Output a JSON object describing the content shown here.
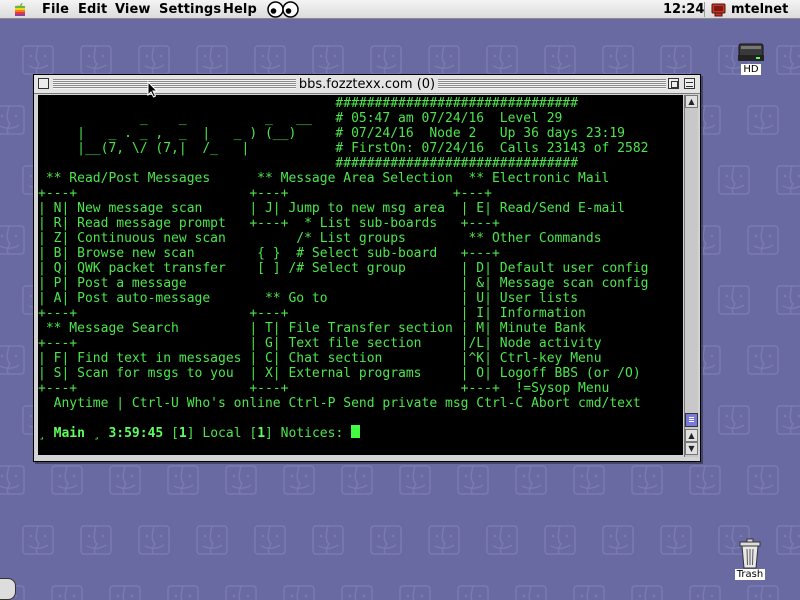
{
  "menubar": {
    "items": [
      "File",
      "Edit",
      "View",
      "Settings",
      "Help"
    ],
    "clock": "12:24",
    "app_name": "mtelnet"
  },
  "desktop": {
    "hd_label": "HD",
    "trash_label": "Trash"
  },
  "window": {
    "title": "bbs.fozztexx.com (0)"
  },
  "terminal": {
    "lines": [
      "                                      ###############################",
      "             _    _          _   __   # 05:47 am 07/24/16  Level 29",
      "     |   _ . _ ,  _  |   _ ) (__)     # 07/24/16  Node 2   Up 36 days 23:19",
      "     |__(7, \\/ (7,|  /_   |           # FirstOn: 07/24/16  Calls 23143 of 2582",
      "                                      ###############################",
      " ** Read/Post Messages      ** Message Area Selection  ** Electronic Mail",
      "+---+                      +---+                     +---+",
      "| N| New message scan      | J| Jump to new msg area  | E| Read/Send E-mail",
      "| R| Read message prompt   +---+  * List sub-boards   +---+",
      "| Z| Continuous new scan         /* List groups        ** Other Commands",
      "| B| Browse new scan        { }  # Select sub-board   +---+",
      "| Q| QWK packet transfer    [ ] /# Select group       | D| Default user config",
      "| P| Post a message                                   | &| Message scan config",
      "| A| Post auto-message       ** Go to                 | U| User lists",
      "+---+                      +---+                      | I| Information",
      " ** Message Search         | T| File Transfer section | M| Minute Bank",
      "+---+                      | G| Text file section     |/L| Node activity",
      "| F| Find text in messages | C| Chat section          |^K| Ctrl-key Menu",
      "| S| Scan for msgs to you  | X| External programs     | O| Logoff BBS (or /O)",
      "+---+                      +---+                      +---+  !=Sysop Menu",
      "  Anytime | Ctrl-U Who's online Ctrl-P Send private msg Ctrl-C Abort cmd/text"
    ],
    "prompt": {
      "lead": "¸ ",
      "area": "Main",
      "sep": " ¸ ",
      "time": "3:59:45",
      "rest1": " [",
      "n1": "1",
      "rest2": "] Local [",
      "n2": "1",
      "rest3": "] Notices: "
    }
  }
}
